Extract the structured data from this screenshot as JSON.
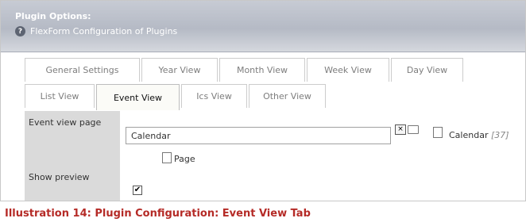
{
  "header": {
    "title": "Plugin Options:",
    "subtitle": "FlexForm Configuration of Plugins",
    "help_icon": "?"
  },
  "tabs": {
    "row1": [
      {
        "label": "General Settings"
      },
      {
        "label": "Year View"
      },
      {
        "label": "Month View"
      },
      {
        "label": "Week View"
      },
      {
        "label": "Day View"
      }
    ],
    "row2": [
      {
        "label": "List View"
      },
      {
        "label": "Event View",
        "active": true
      },
      {
        "label": "Ics View"
      },
      {
        "label": "Other View"
      }
    ]
  },
  "form": {
    "event_view_page": {
      "label": "Event view page",
      "value": "Calendar",
      "selected_page_title": "Calendar",
      "selected_page_id": "[37]",
      "page_button_label": "Page"
    },
    "show_preview": {
      "label": "Show preview",
      "checked": true,
      "check_mark": "✔"
    }
  },
  "caption": "Illustration 14: Plugin Configuration: Event View Tab",
  "colors": {
    "caption": "#b52b27",
    "label_column": "#dadada",
    "header": "#b5bac5"
  }
}
